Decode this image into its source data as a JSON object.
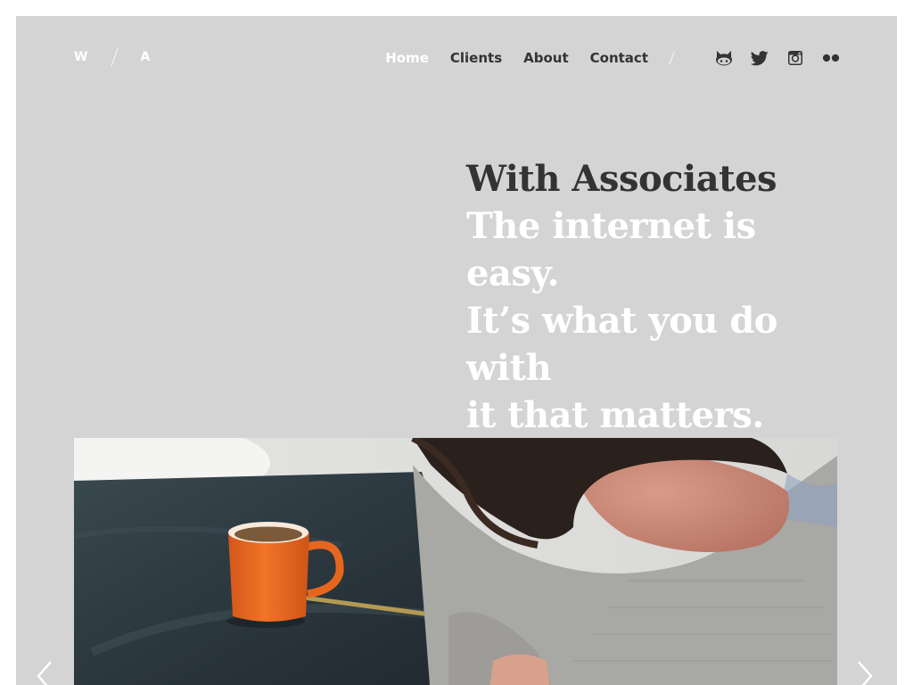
{
  "brand": {
    "letter_left": "W",
    "letter_right": "A"
  },
  "nav": {
    "items": [
      {
        "label": "Home",
        "active": true
      },
      {
        "label": "Clients",
        "active": false
      },
      {
        "label": "About",
        "active": false
      },
      {
        "label": "Contact",
        "active": false
      }
    ],
    "social_icons": [
      "github-icon",
      "twitter-icon",
      "instagram-icon",
      "flickr-icon"
    ]
  },
  "hero": {
    "title": "With Associates",
    "tagline_line1": "The internet is easy.",
    "tagline_line2": "It’s what you do with",
    "tagline_line3": "it that matters."
  },
  "colors": {
    "background": "#d4d4d4",
    "text_dark": "#333333",
    "text_light": "#ffffff",
    "mug": "#ee6a1e"
  },
  "carousel": {
    "prev_icon": "chevron-left-icon",
    "next_icon": "chevron-right-icon"
  }
}
